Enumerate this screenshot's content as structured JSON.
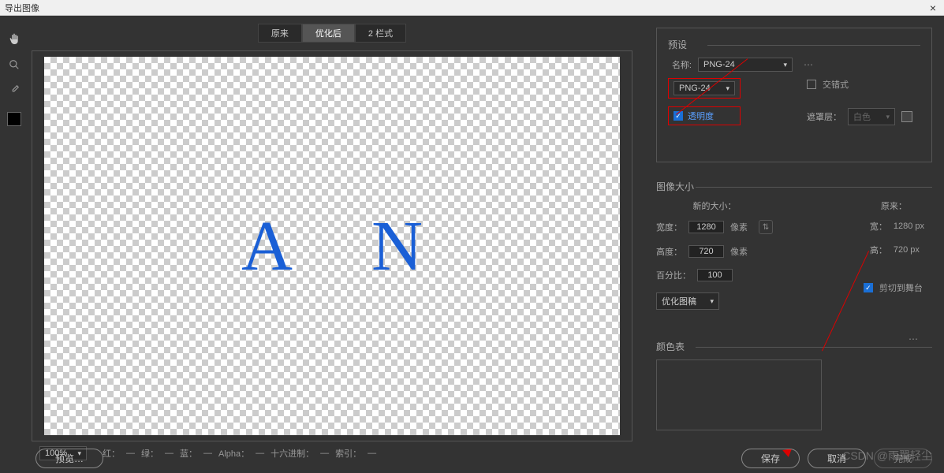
{
  "window": {
    "title": "导出图像"
  },
  "tabs": {
    "original": "原来",
    "optimized": "优化后",
    "twoup": "2 栏式"
  },
  "canvas": {
    "letter_a": "A",
    "letter_n": "N"
  },
  "bottombar": {
    "zoom": "100%",
    "r": "红：",
    "g": "绿：",
    "b": "蓝：",
    "alpha": "Alpha：",
    "hex": "十六进制：",
    "index": "索引："
  },
  "buttons": {
    "preview": "预览…",
    "save": "保存",
    "cancel": "取消",
    "done": "完成"
  },
  "preset": {
    "title": "预设",
    "name_label": "名称:",
    "name_value": "PNG-24",
    "format": "PNG-24",
    "transparency": "透明度",
    "interlaced": "交错式",
    "matte_label": "遮罩层：",
    "matte_value": "白色"
  },
  "image_size": {
    "title": "图像大小",
    "new_size": "新的大小：",
    "original": "原来：",
    "w_label": "宽度：",
    "w_value": "1280",
    "w_unit": "像素",
    "h_label": "高度：",
    "h_value": "720",
    "h_unit": "像素",
    "pct_label": "百分比：",
    "pct_value": "100",
    "menu": "优化图稿",
    "orig_w_label": "宽：",
    "orig_w": "1280 px",
    "orig_h_label": "高：",
    "orig_h": "720 px",
    "clip": "剪切到舞台"
  },
  "color_table": {
    "title": "颜色表"
  },
  "watermark": "CSDN @雨翼轻尘"
}
